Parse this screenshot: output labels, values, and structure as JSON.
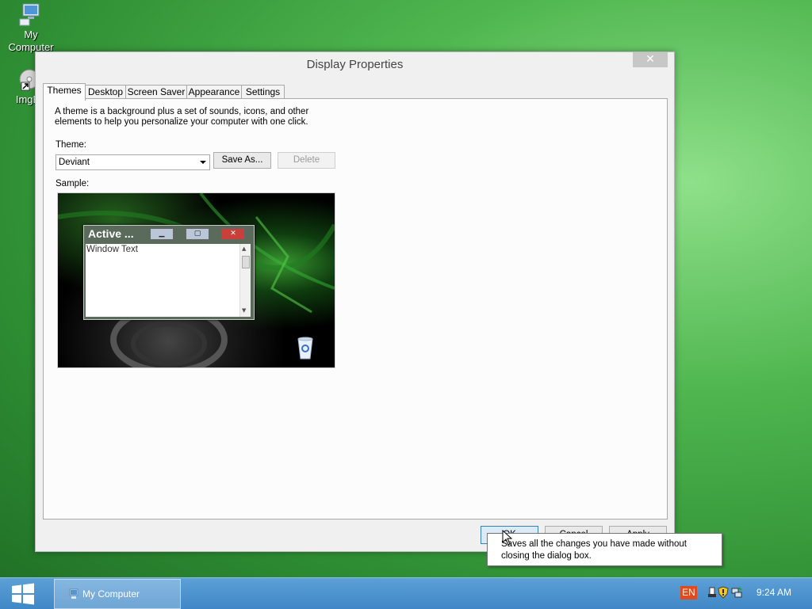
{
  "desktop": {
    "icons": [
      {
        "label": "My\nComputer",
        "icon": "computer-icon"
      },
      {
        "label": "ImgB",
        "icon": "disc-shortcut-icon"
      }
    ]
  },
  "dialog": {
    "title": "Display Properties",
    "close_label": "✕",
    "tabs": [
      "Themes",
      "Desktop",
      "Screen Saver",
      "Appearance",
      "Settings"
    ],
    "active_tab": "Themes",
    "description": "A theme is a background plus a set of sounds, icons, and other elements to help you personalize your computer with one click.",
    "theme_label": "Theme:",
    "theme_value": "Deviant",
    "save_as_label": "Save As...",
    "delete_label": "Delete",
    "sample_label": "Sample:",
    "sample": {
      "window_title": "Active ...",
      "window_text": "Window Text"
    },
    "buttons": {
      "ok": "OK",
      "cancel": "Cancel",
      "apply": "Apply"
    }
  },
  "tooltip": {
    "text": "Saves all the changes you have made without closing the dialog box."
  },
  "taskbar": {
    "task_label": "My Computer",
    "language": "EN",
    "clock": "9:24 AM"
  }
}
